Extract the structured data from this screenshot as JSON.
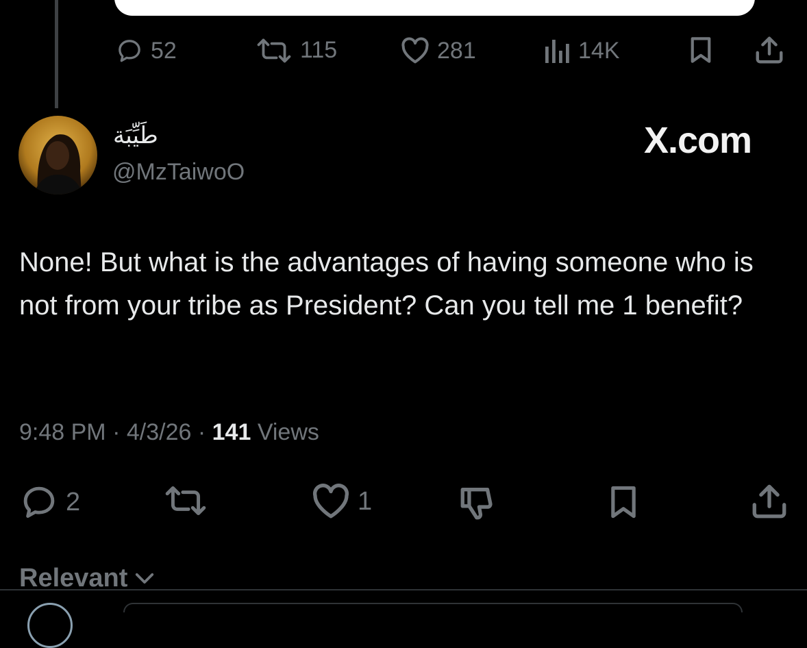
{
  "parent_tweet": {
    "stats": {
      "replies": "52",
      "reposts": "115",
      "likes": "281",
      "views": "14K"
    }
  },
  "tweet": {
    "author_name": "طَيِّبَة",
    "handle": "@MzTaiwoO",
    "brand": "X.com",
    "text": "None! But what is the advantages of having someone who is not from your tribe as President? Can you tell me 1 benefit?",
    "time": "9:48 PM",
    "sep1": "·",
    "date": "4/3/26",
    "sep2": "·",
    "views_count": "141",
    "views_label": "Views",
    "stats": {
      "replies": "2",
      "likes": "1"
    }
  },
  "footer": {
    "sort_label": "Relevant"
  },
  "icons": {
    "reply": "reply-icon",
    "repost": "repost-icon",
    "like": "heart-icon",
    "views": "views-icon",
    "bookmark": "bookmark-icon",
    "share": "share-icon",
    "dislike": "thumbs-down-icon",
    "chevron": "chevron-down-icon"
  },
  "colors": {
    "background": "#000000",
    "text_primary": "#e7e9ea",
    "text_secondary": "#71767b"
  }
}
